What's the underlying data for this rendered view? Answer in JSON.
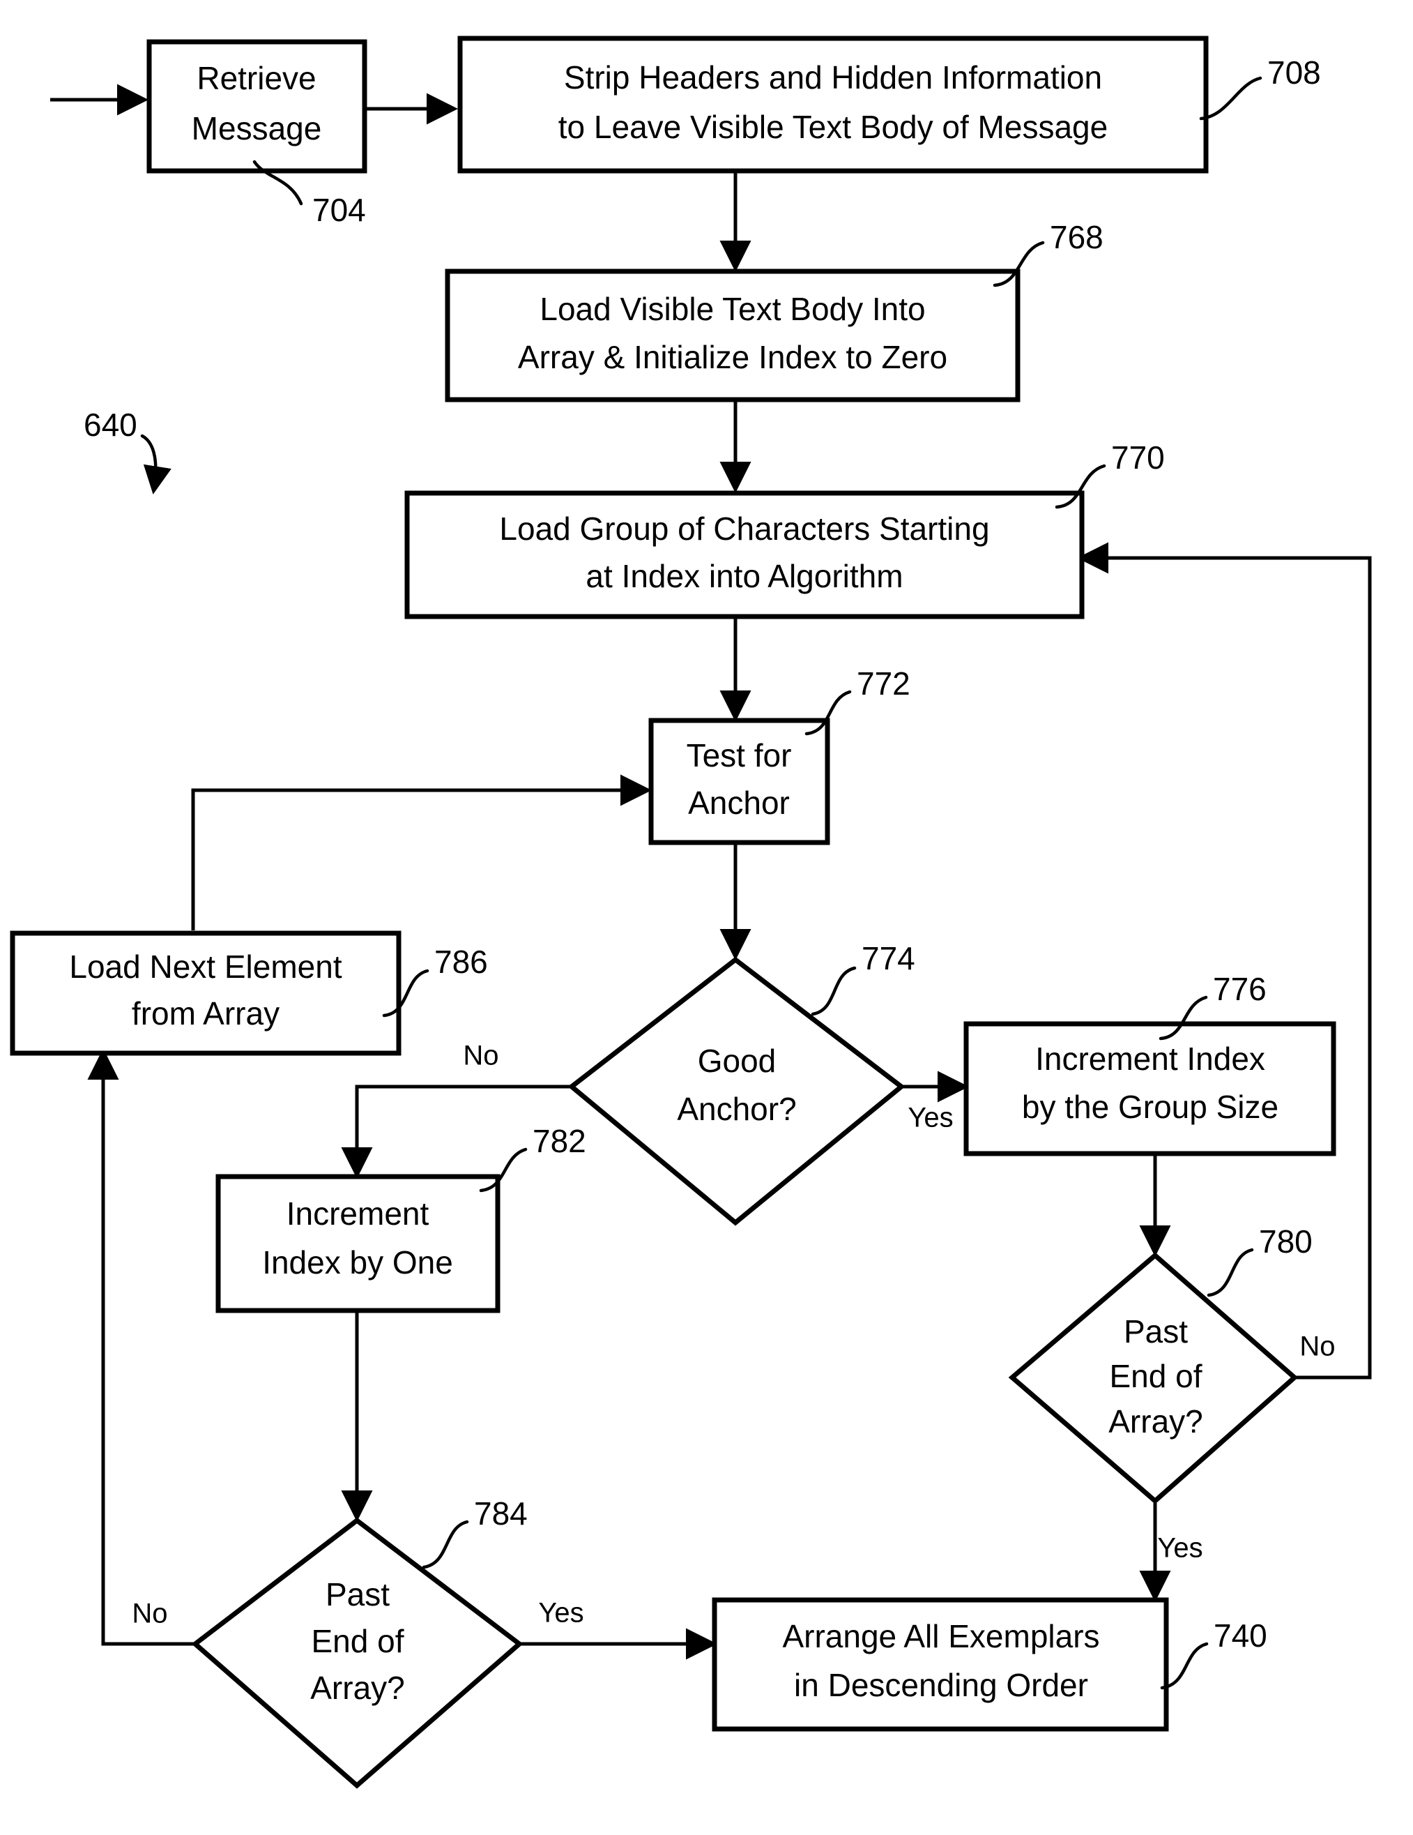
{
  "figure": {
    "figure_number": "640"
  },
  "nodes": [
    {
      "id": "retrieve-message",
      "ref": "704",
      "shape": "process",
      "lines": [
        "Retrieve",
        "Message"
      ]
    },
    {
      "id": "strip-headers",
      "ref": "708",
      "shape": "process",
      "lines": [
        "Strip Headers and Hidden Information",
        "to Leave Visible Text Body of Message"
      ]
    },
    {
      "id": "load-visible-text-body",
      "ref": "768",
      "shape": "process",
      "lines": [
        "Load Visible Text Body Into",
        "Array & Initialize Index to Zero"
      ]
    },
    {
      "id": "load-group-of-characters",
      "ref": "770",
      "shape": "process",
      "lines": [
        "Load Group of Characters Starting",
        "at Index into Algorithm"
      ]
    },
    {
      "id": "test-for-anchor",
      "ref": "772",
      "shape": "process",
      "lines": [
        "Test for",
        "Anchor"
      ]
    },
    {
      "id": "good-anchor",
      "ref": "774",
      "shape": "decision",
      "lines": [
        "Good",
        "Anchor?"
      ]
    },
    {
      "id": "increment-index-group-size",
      "ref": "776",
      "shape": "process",
      "lines": [
        "Increment Index",
        "by the Group Size"
      ]
    },
    {
      "id": "past-end-of-array-right",
      "ref": "780",
      "shape": "decision",
      "lines": [
        "Past",
        "End of",
        "Array?"
      ]
    },
    {
      "id": "increment-index-by-one",
      "ref": "782",
      "shape": "process",
      "lines": [
        "Increment",
        "Index by One"
      ]
    },
    {
      "id": "past-end-of-array-left",
      "ref": "784",
      "shape": "decision",
      "lines": [
        "Past",
        "End of",
        "Array?"
      ]
    },
    {
      "id": "load-next-element",
      "ref": "786",
      "shape": "process",
      "lines": [
        "Load Next Element",
        "from Array"
      ]
    },
    {
      "id": "arrange-exemplars",
      "ref": "740",
      "shape": "process",
      "lines": [
        "Arrange All Exemplars",
        "in Descending Order"
      ]
    }
  ],
  "edge_labels": {
    "good_anchor_no": "No",
    "good_anchor_yes": "Yes",
    "past_end_right_no": "No",
    "past_end_right_yes": "Yes",
    "past_end_left_no": "No",
    "past_end_left_yes": "Yes"
  },
  "colors": {
    "stroke": "#000000",
    "fill": "#ffffff"
  }
}
